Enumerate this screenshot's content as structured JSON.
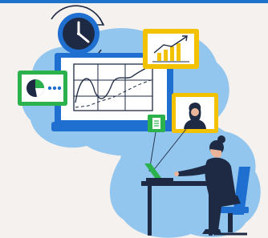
{
  "illustration": {
    "subject": "remote-work-analytics",
    "icons": [
      "clock-icon",
      "pie-chart-icon",
      "bar-chart-icon",
      "video-call-icon",
      "document-icon"
    ],
    "colors": {
      "accent_bar": "#1e73c8",
      "blob": "#92c6ee",
      "monitor_frame": "#1f6fd1",
      "green_card": "#2bb24c",
      "yellow_card": "#f2c200",
      "navy": "#1e2a44"
    }
  }
}
